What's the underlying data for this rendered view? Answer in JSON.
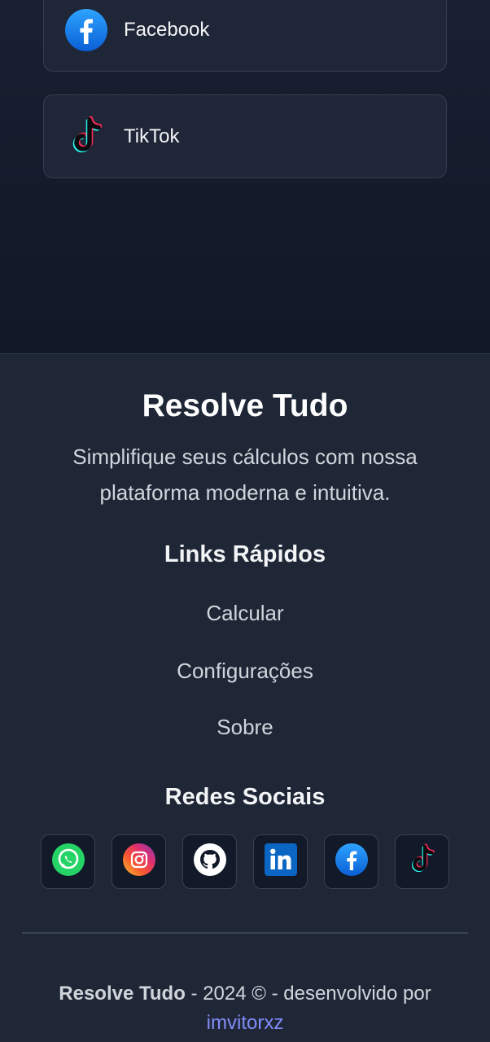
{
  "social_cards": [
    {
      "label": "Facebook",
      "icon": "facebook-icon"
    },
    {
      "label": "TikTok",
      "icon": "tiktok-icon"
    }
  ],
  "footer": {
    "brand": "Resolve Tudo",
    "tagline": "Simplifique seus cálculos com nossa plataforma moderna e intuitiva.",
    "quick_links_title": "Links Rápidos",
    "quick_links": [
      "Calcular",
      "Configurações",
      "Sobre"
    ],
    "social_title": "Redes Sociais",
    "social_icons": [
      "whatsapp-icon",
      "instagram-icon",
      "github-icon",
      "linkedin-icon",
      "facebook-icon",
      "tiktok-icon"
    ],
    "copyright_brand": "Resolve Tudo",
    "copyright_text": " - 2024 © - desenvolvido por",
    "author": "imvitorxz"
  },
  "colors": {
    "background_top": "#111827",
    "footer_bg": "#1f2737",
    "card_bg": "#1f2637",
    "author_link": "#818cf8"
  }
}
